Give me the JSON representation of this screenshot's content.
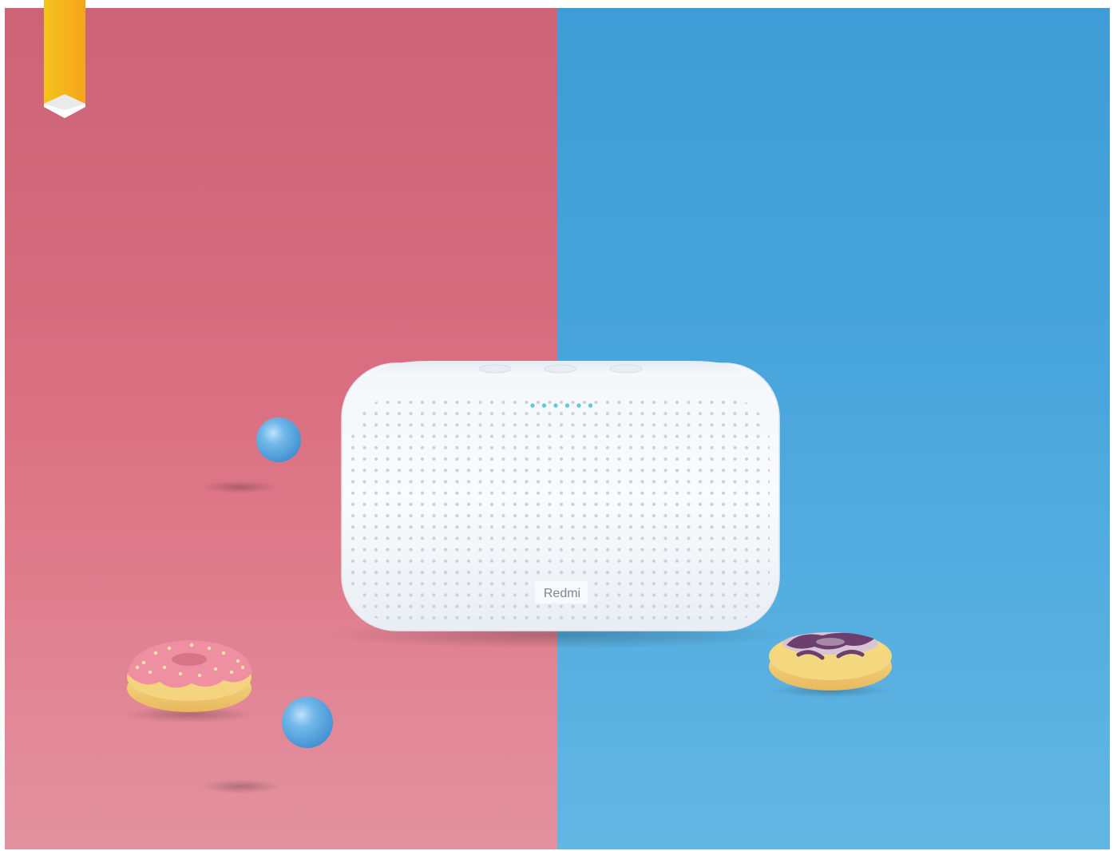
{
  "scene": {
    "speaker": {
      "brand_label": "Redmi",
      "led_color": "#5ec9d6",
      "led_count": 6,
      "body_color": "#f6f8fb"
    },
    "background": {
      "left_color": "#d96b7e",
      "right_color": "#4aa6dc",
      "frame_color": "#ffffff"
    },
    "bookmark": {
      "color": "#f6b91a",
      "icon": "bookmark-icon"
    },
    "props": {
      "ball_color": "#5aa8e2",
      "left_donut_glaze": "#ef8aa0",
      "right_donut_glaze": "#7a4a7e",
      "donut_dough": "#f2d67a"
    }
  }
}
